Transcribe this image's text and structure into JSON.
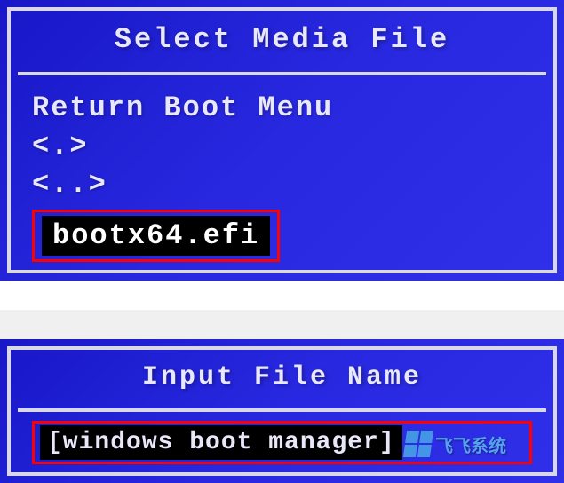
{
  "top_panel": {
    "title": "Select Media File",
    "items": {
      "return_menu": "Return Boot Menu",
      "dir_current": "<.>",
      "dir_parent": "<..>",
      "selected_file": "bootx64.efi"
    }
  },
  "bottom_panel": {
    "title": "Input File Name",
    "input_value": "[windows boot manager]"
  },
  "watermark": {
    "text": "飞飞系统",
    "logo_name": "windows-logo"
  }
}
